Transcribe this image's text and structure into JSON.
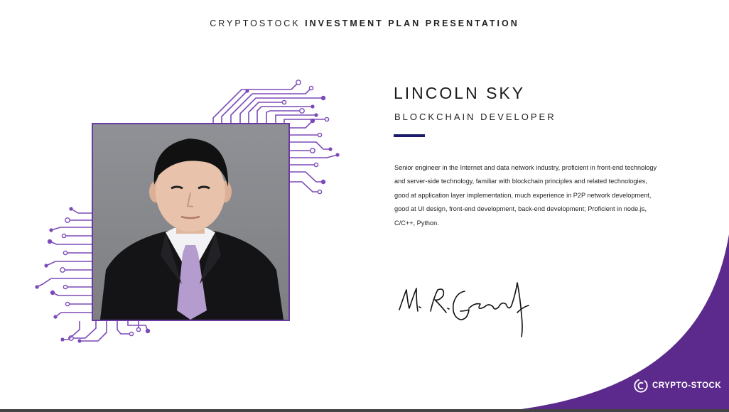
{
  "header": {
    "brand": "CRYPTOSTOCK",
    "title": "INVESTMENT PLAN PRESENTATION"
  },
  "profile": {
    "name": "LINCOLN SKY",
    "role": "BLOCKCHAIN DEVELOPER",
    "bio": "Senior engineer in the Internet and data network industry, proficient in front-end technology and server-side technology, familiar with blockchain principles and related technologies, good at application layer implementation, much experience in P2P network development, good at UI design, front-end development, back-end development; Proficient in node.js, C/C++, Python.",
    "signature": "M. R. Green"
  },
  "logo": {
    "text": "CRYPTO-STOCK",
    "icon": "crypto-stock-logo-icon"
  },
  "colors": {
    "accent_purple": "#5b2a8c",
    "circuit_purple": "#7c4ab8",
    "accent_navy": "#1b1a6b"
  }
}
